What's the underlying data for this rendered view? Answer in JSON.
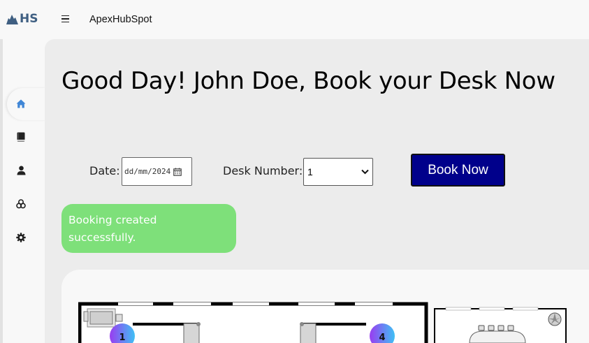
{
  "app": {
    "logo_text": "HS",
    "title": "ApexHubSpot"
  },
  "sidebar": {
    "items": [
      {
        "icon": "home-icon",
        "active": true
      },
      {
        "icon": "book-icon",
        "active": false
      },
      {
        "icon": "user-icon",
        "active": false
      },
      {
        "icon": "rooms-icon",
        "active": false
      },
      {
        "icon": "settings-icon",
        "active": false
      }
    ]
  },
  "main": {
    "greeting": "Good Day! John Doe, Book your Desk Now",
    "form": {
      "date_label": "Date:",
      "date_placeholder": "dd/mm/2024",
      "desk_label": "Desk Number:",
      "desk_value": "1",
      "book_button": "Book Now"
    },
    "toast": {
      "line1": "Booking created",
      "line2": "successfully."
    },
    "floor_plan": {
      "desk_badges": [
        "1",
        "4"
      ]
    }
  },
  "colors": {
    "accent": "#3f86d6",
    "logo": "#3f5f82",
    "book_button": "#00008b",
    "toast": "#7ee07a",
    "badge_gradient": [
      "#9a3cf0",
      "#3fc0f5"
    ]
  }
}
